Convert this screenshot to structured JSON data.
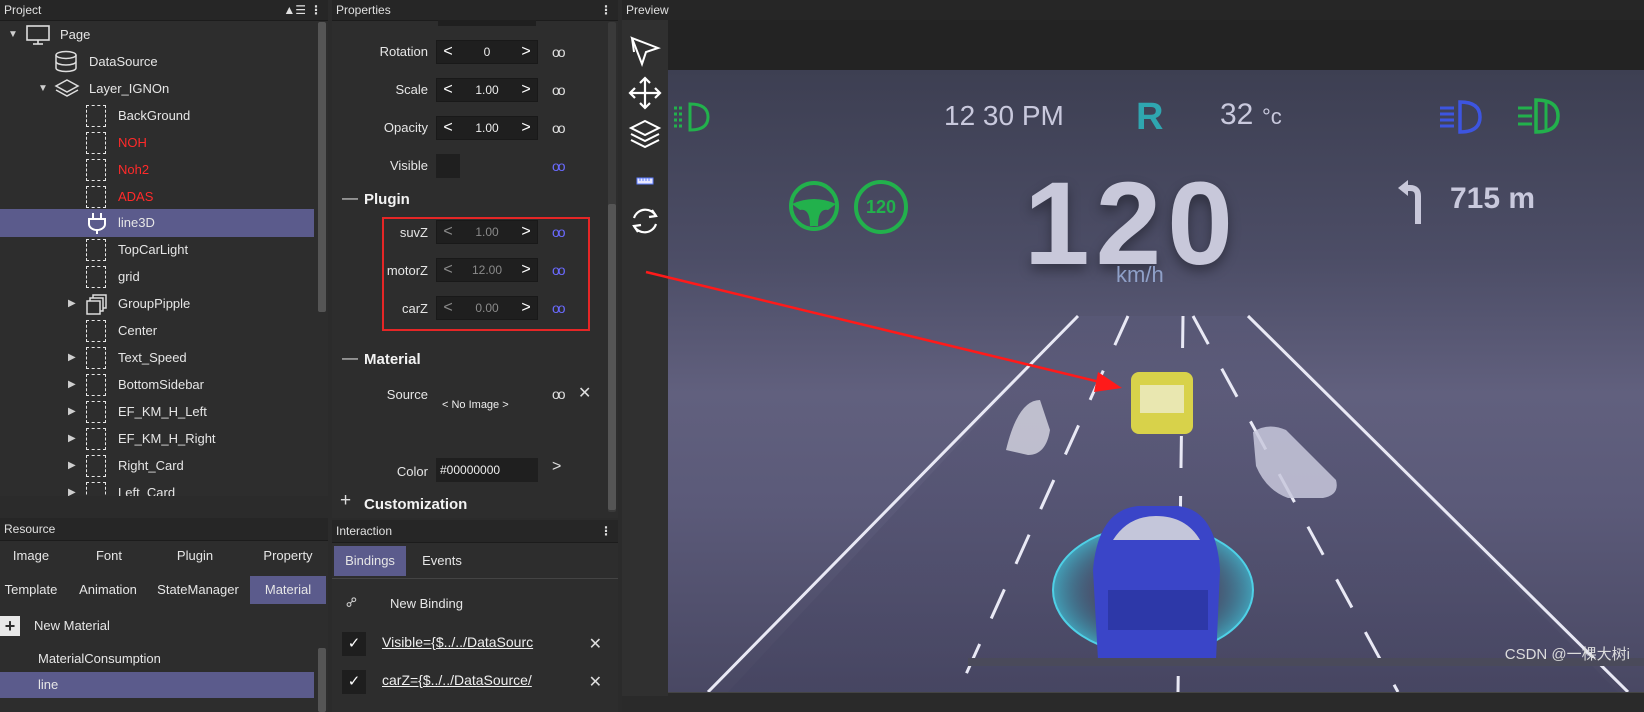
{
  "project": {
    "title": "Project",
    "items": [
      {
        "label": "Page"
      },
      {
        "label": "DataSource"
      },
      {
        "label": "Layer_IGNOn"
      },
      {
        "label": "BackGround"
      },
      {
        "label": "NOH"
      },
      {
        "label": "Noh2"
      },
      {
        "label": "ADAS"
      },
      {
        "label": "line3D"
      },
      {
        "label": "TopCarLight"
      },
      {
        "label": "grid"
      },
      {
        "label": "GroupPipple"
      },
      {
        "label": "Center"
      },
      {
        "label": "Text_Speed"
      },
      {
        "label": "BottomSidebar"
      },
      {
        "label": "EF_KM_H_Left"
      },
      {
        "label": "EF_KM_H_Right"
      },
      {
        "label": "Right_Card"
      },
      {
        "label": "Left_Card"
      }
    ]
  },
  "properties": {
    "title": "Properties",
    "rotation": {
      "label": "Rotation",
      "value": "0"
    },
    "scale": {
      "label": "Scale",
      "value": "1.00"
    },
    "opacity": {
      "label": "Opacity",
      "value": "1.00"
    },
    "visible": {
      "label": "Visible"
    },
    "plugin_section": "Plugin",
    "suvZ": {
      "label": "suvZ",
      "value": "1.00"
    },
    "motorZ": {
      "label": "motorZ",
      "value": "12.00"
    },
    "carZ": {
      "label": "carZ",
      "value": "0.00"
    },
    "material_section": "Material",
    "source": {
      "label": "Source",
      "value": "< No Image >"
    },
    "color": {
      "label": "Color",
      "value": "#00000000"
    },
    "customization_section": "Customization"
  },
  "resource": {
    "title": "Resource",
    "tabs_row1": [
      "Image",
      "Font",
      "Plugin",
      "Property"
    ],
    "tabs_row2": [
      "Template",
      "Animation",
      "StateManager",
      "Material"
    ],
    "active_tab": "Material",
    "new_material": "New Material",
    "items": [
      "MaterialConsumption",
      "line"
    ]
  },
  "interaction": {
    "title": "Interaction",
    "tabs": [
      "Bindings",
      "Events"
    ],
    "active_tab": "Bindings",
    "new_binding": "New Binding",
    "bindings": [
      "Visible={$../../DataSourc",
      "carZ={$../../DataSource/"
    ]
  },
  "preview": {
    "title": "Preview",
    "time": "12 30 PM",
    "gear": "R",
    "temperature": "32",
    "temp_unit": "°c",
    "speed": "120",
    "speed_unit": "km/h",
    "speed_limit": "120",
    "distance": "715 m",
    "watermark": "CSDN @一棵大树i",
    "colors": {
      "green": "#22b14c",
      "blue": "#3d55e0",
      "teal": "#2fa6b0"
    }
  }
}
